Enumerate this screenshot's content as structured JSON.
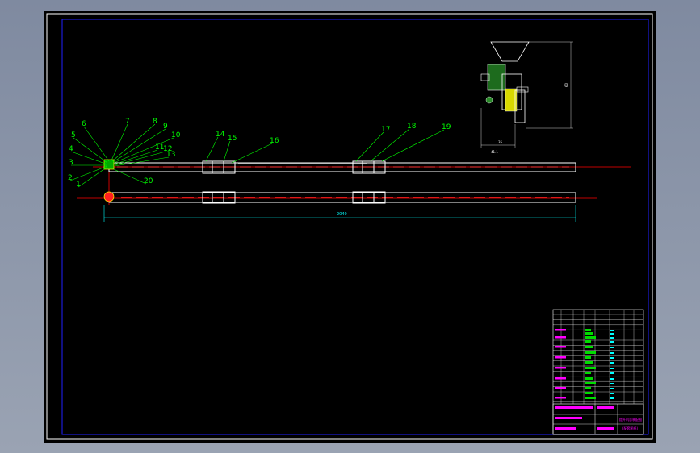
{
  "colors": {
    "background": "#8c96a6",
    "sheet": "#000000",
    "border": "#ffffff",
    "inner_frame": "#0000ff",
    "leader": "#00ff00",
    "centerline": "#ff0000",
    "dimension": "#00ffff",
    "title_text": "#ff00ff"
  },
  "balloons": [
    "1",
    "2",
    "3",
    "4",
    "5",
    "6",
    "7",
    "8",
    "9",
    "10",
    "11",
    "12",
    "13",
    "14",
    "15",
    "16",
    "17",
    "18",
    "19",
    "20"
  ],
  "dimensions": {
    "overall_length": "2040",
    "detail_width": "35",
    "detail_sub": "41.1",
    "detail_height": "60"
  },
  "title_block": {
    "drawing_name": "提升机总装配图",
    "drawing_sub": "(配套图纸)"
  }
}
